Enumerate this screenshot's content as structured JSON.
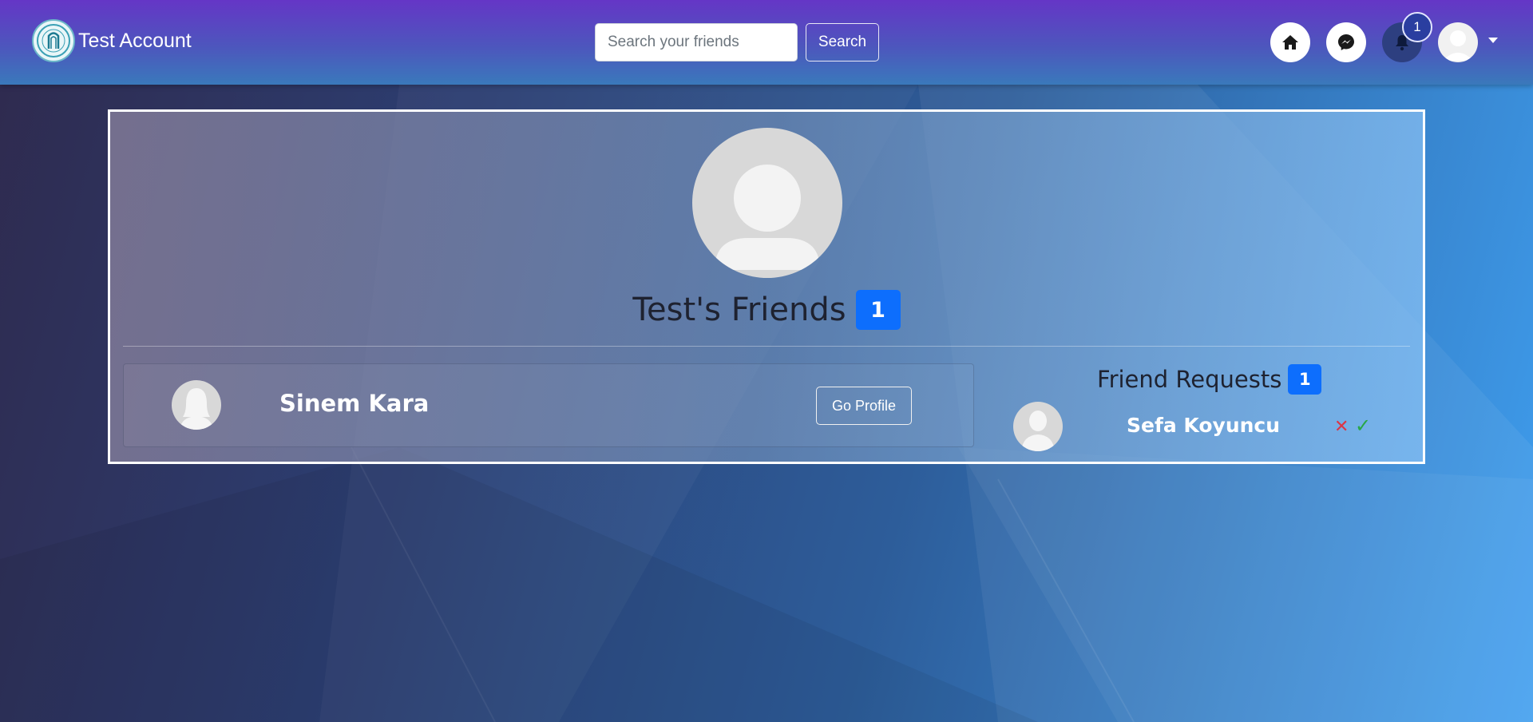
{
  "navbar": {
    "brand_name": "Test Account",
    "logo_icon": "university-seal-icon",
    "search": {
      "placeholder": "Search your friends",
      "value": ""
    },
    "search_button": "Search",
    "icons": [
      "home-icon",
      "messenger-icon",
      "bell-icon",
      "user-avatar-icon",
      "caret-down-icon"
    ],
    "notification_count": "1"
  },
  "main": {
    "friends_title": "Test's Friends",
    "friends_count": "1",
    "friends": [
      {
        "name": "Sinem Kara",
        "button": "Go Profile",
        "avatar": "female-avatar-icon"
      }
    ],
    "requests": {
      "title": "Friend Requests",
      "count": "1",
      "items": [
        {
          "name": "Sefa Koyuncu",
          "avatar": "male-avatar-icon",
          "reject_icon": "close-icon",
          "accept_icon": "check-icon"
        }
      ]
    }
  },
  "colors": {
    "badge": "#0d6efd",
    "reject": "#dc3545",
    "accept": "#28a745",
    "navbar_top": "#6536c6",
    "navbar_bottom": "#3a79bb"
  }
}
